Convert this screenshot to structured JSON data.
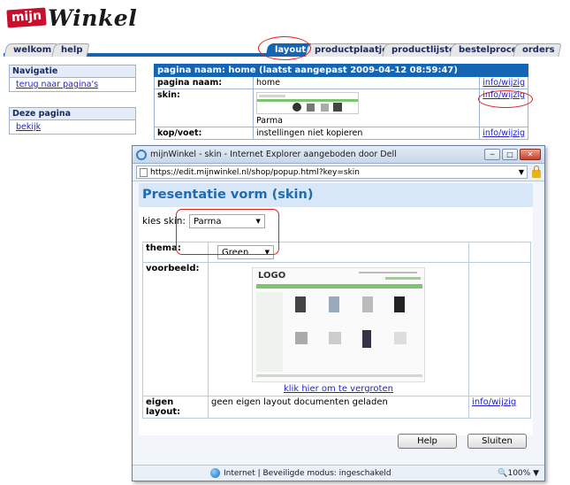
{
  "logo": {
    "prefix": "mijn",
    "name": "Winkel"
  },
  "tabs": [
    {
      "label": "welkom"
    },
    {
      "label": "help"
    },
    {
      "label": "layout",
      "active": true
    },
    {
      "label": "productplaatjes"
    },
    {
      "label": "productlijsten"
    },
    {
      "label": "bestelproces"
    },
    {
      "label": "orders"
    }
  ],
  "sidebar": {
    "nav_title": "Navigatie",
    "nav_link": "terug naar pagina's",
    "page_title": "Deze pagina",
    "page_link": "bekijk"
  },
  "main_table": {
    "header": "pagina naam: home (laatst aangepast  2009-04-12 08:59:47)",
    "rows": [
      {
        "label": "pagina naam:",
        "value": "home",
        "action": "info/wijzig"
      },
      {
        "label": "skin:",
        "value": "Parma",
        "action": "info/wijzig"
      },
      {
        "label": "kop/voet:",
        "value": "instellingen niet kopieren",
        "action": "info/wijzig"
      }
    ]
  },
  "popup": {
    "title": "mijnWinkel - skin - Internet Explorer aangeboden door Dell",
    "url": "https://edit.mijnwinkel.nl/shop/popup.html?key=skin",
    "heading": "Presentatie vorm (skin)",
    "kies_label": "kies skin:",
    "skin_value": "Parma",
    "thema_label": "thema:",
    "thema_value": "Green",
    "voorbeeld_label": "voorbeeld:",
    "preview_logo": "LOGO",
    "enlarge_link": "klik hier om te vergroten",
    "eigen_label": "eigen layout:",
    "eigen_value": "geen eigen layout documenten geladen",
    "eigen_action": "info/wijzig",
    "help_button": "Help",
    "close_button": "Sluiten",
    "status_text": "Internet | Beveiligde modus: ingeschakeld",
    "zoom": "100%"
  },
  "colors": {
    "accent": "#1565b5",
    "highlight": "#e0201e",
    "link": "#2222cc"
  }
}
